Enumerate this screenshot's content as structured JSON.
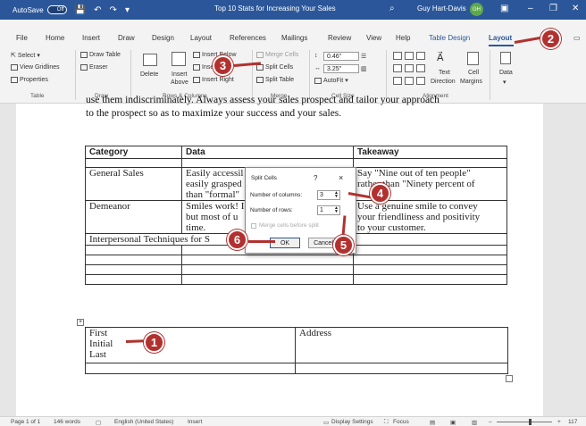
{
  "titlebar": {
    "autosave_label": "AutoSave",
    "autosave_state": "Off",
    "doc_title": "Top 10 Stats for Increasing Your Sales",
    "user_name": "Guy Hart-Davis",
    "user_initials": "GH",
    "accent": "#2b579a"
  },
  "menu": {
    "tabs": [
      "File",
      "Home",
      "Insert",
      "Draw",
      "Design",
      "Layout",
      "References",
      "Mailings",
      "Review",
      "View",
      "Help",
      "Table Design",
      "Layout"
    ]
  },
  "ribbon": {
    "table": {
      "select": "Select",
      "gridlines": "View Gridlines",
      "properties": "Properties",
      "group": "Table"
    },
    "draw": {
      "draw_table": "Draw Table",
      "eraser": "Eraser",
      "group": "Draw"
    },
    "rows_columns": {
      "delete": "Delete",
      "insert_above_1": "Insert",
      "insert_above_2": "Above",
      "insert_below": "Insert Below",
      "insert_left": "Insert Left",
      "insert_right": "Insert Right",
      "group": "Rows & Columns"
    },
    "merge": {
      "merge_cells": "Merge Cells",
      "split_cells": "Split Cells",
      "split_table": "Split Table",
      "group": "Merge"
    },
    "cell_size": {
      "height": "0.46\"",
      "width": "3.25\"",
      "autofit": "AutoFit",
      "group": "Cell Size"
    },
    "alignment": {
      "text_direction_1": "Text",
      "text_direction_2": "Direction",
      "cell_margins_1": "Cell",
      "cell_margins_2": "Margins",
      "group": "Alignment"
    },
    "data": {
      "label": "Data"
    }
  },
  "document": {
    "para_line1": "use them indiscriminately. Always assess your sales prospect and tailor your approach",
    "para_line2": "to the prospect so as to maximize your success and your sales.",
    "table1": {
      "headers": [
        "Category",
        "Data",
        "Takeaway"
      ],
      "rows": [
        {
          "category": "General Sales",
          "data": [
            "Easily accessil",
            "easily grasped",
            "than \"formal\""
          ],
          "takeaway": [
            "Say \"Nine out of ten people\"",
            "rather than \"Ninety percent of"
          ]
        },
        {
          "category": "Demeanor",
          "data": [
            "Smiles work! I",
            "but most of u",
            "time."
          ],
          "takeaway": [
            "Use a genuine smile to convey",
            "your friendliness and positivity",
            "to your customer."
          ]
        },
        {
          "category": "Interpersonal Techniques for S",
          "data": [],
          "takeaway": []
        }
      ]
    },
    "table2": {
      "col1": [
        "First",
        "Initial",
        "Last"
      ],
      "col2": "Address"
    }
  },
  "dialog": {
    "title": "Split Cells",
    "help": "?",
    "close": "×",
    "columns_label": "Number of columns:",
    "columns_value": "3",
    "rows_label": "Number of rows:",
    "rows_value": "1",
    "merge_label": "Merge cells before split",
    "ok": "OK",
    "cancel": "Cancel"
  },
  "callouts": [
    "1",
    "2",
    "3",
    "4",
    "5",
    "6"
  ],
  "statusbar": {
    "page": "Page 1 of 1",
    "words": "146 words",
    "language": "English (United States)",
    "mode": "Insert",
    "display_settings": "Display Settings",
    "focus": "Focus",
    "zoom_value": "117"
  }
}
